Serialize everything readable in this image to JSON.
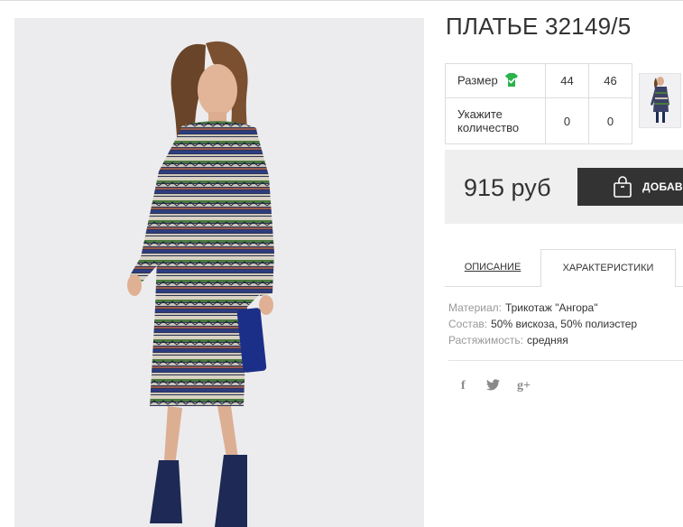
{
  "product": {
    "title": "ПЛАТЬЕ 32149/5"
  },
  "sizes": {
    "size_label": "Размер",
    "quantity_label_line1": "Укажите",
    "quantity_label_line2": "количество",
    "options": [
      {
        "size": "44",
        "quantity": "0"
      },
      {
        "size": "46",
        "quantity": "0"
      }
    ]
  },
  "price": {
    "value": "915 руб",
    "add_button_label": "ДОБАВИТЬ В КОРЗИНУ"
  },
  "tabs": [
    {
      "label": "ОПИСАНИЕ",
      "active": false
    },
    {
      "label": "ХАРАКТЕРИСТИКИ",
      "active": true
    }
  ],
  "characteristics": [
    {
      "key": "Материал:",
      "value": "Трикотаж \"Ангора\""
    },
    {
      "key": "Состав:",
      "value": "50% вискоза, 50% полиэстер"
    },
    {
      "key": "Растяжимость:",
      "value": "средняя"
    }
  ],
  "social": {
    "facebook": "f",
    "twitter": "twitter-icon",
    "googleplus": "g+"
  },
  "icons": {
    "size_check": "size-chart-check-icon",
    "cart_bag": "shopping-bag-icon"
  },
  "colors": {
    "accent_green": "#2bb24c",
    "button_dark": "#333333",
    "price_bg": "#efefef"
  }
}
